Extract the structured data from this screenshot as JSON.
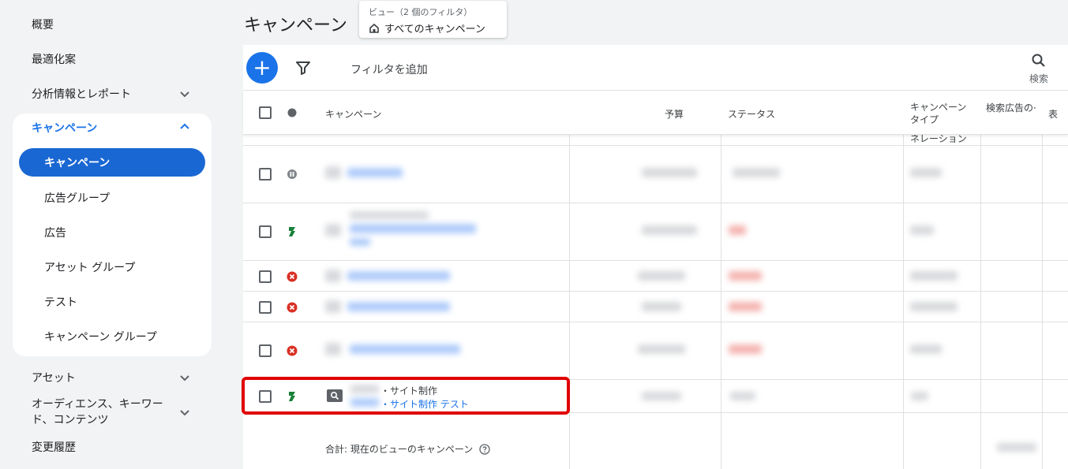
{
  "sidebar": {
    "overview": "概要",
    "recommendations": "最適化案",
    "insights_reports": "分析情報とレポート",
    "campaigns_group": "キャンペーン",
    "sub_items": [
      "キャンペーン",
      "広告グループ",
      "広告",
      "アセット グループ",
      "テスト",
      "キャンペーン グループ"
    ],
    "assets": "アセット",
    "audiences_line1": "オーディエンス、キーワー",
    "audiences_line2": "ド、コンテンツ",
    "change_history": "変更履歴"
  },
  "header": {
    "title": "キャンペーン",
    "view_caption": "ビュー（2 個のフィルタ）",
    "view_value": "すべてのキャンペーン"
  },
  "toolbar": {
    "add_filter": "フィルタを追加",
    "search_label": "検索"
  },
  "table": {
    "columns": {
      "campaign": "キャンペーン",
      "budget": "予算",
      "status": "ステータス",
      "campaign_type_line1": "キャンペーン",
      "campaign_type_line2": "タイプ",
      "search_ads": "検索広告の·",
      "next": "表"
    },
    "partial_type_text": "ネレーション",
    "highlighted_row": {
      "line1": "・サイト制作",
      "line2": "・サイト制作 テスト"
    },
    "total_label": "合計: 現在のビューのキャンペーン"
  },
  "colors": {
    "accent": "#1a73e8",
    "active_nav": "#1967d2",
    "highlight_border": "#e00000",
    "enabled_green": "#188038",
    "removed_red": "#d93025"
  }
}
